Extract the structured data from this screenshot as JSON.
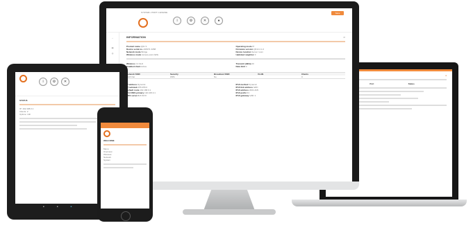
{
  "monitor": {
    "header_title": "SYSTEM • PORT 1 ENGINE",
    "toolbar_button": "Save",
    "info_title": "INFORMATION",
    "left_fields": [
      {
        "label": "Product name",
        "value": "Q61 S"
      },
      {
        "label": "Device serial no.",
        "value": "A08371 3058"
      },
      {
        "label": "Network mode",
        "value": "Bridge"
      },
      {
        "label": "Wireless mode",
        "value": "Access point (W2)"
      }
    ],
    "right_fields": [
      {
        "label": "Operating mode",
        "value": "IP"
      },
      {
        "label": "Firmware version",
        "value": "Q614 2.1.0"
      },
      {
        "label": "Device location",
        "value": "Server room"
      },
      {
        "label": "Uplinked neighbor",
        "value": "3"
      }
    ],
    "section2_fields": [
      {
        "label": "Wireless",
        "value": "2.4 GHz"
      },
      {
        "label": "Enabled client",
        "value": "Active"
      },
      {
        "label": "Transmit (dBm)",
        "value": "20"
      },
      {
        "label": "Data limit",
        "value": "0"
      }
    ],
    "table_headers": [
      "Network SSID",
      "Security",
      "Broadcast SSID",
      "VLAN",
      "Clients"
    ],
    "table_row": [
      "Sixth Net",
      "WPA",
      "No",
      "",
      "0"
    ],
    "bottom_left": [
      {
        "label": "IP address",
        "value": "Dynamic"
      },
      {
        "label": "IP netmask",
        "value": "255.255.0"
      },
      {
        "label": "Default route",
        "value": "192.168.0.1"
      },
      {
        "label": "IPv4 DNS primary",
        "value": "192.168.0.1"
      },
      {
        "label": "DNS server 1",
        "value": "8.8.8.8"
      },
      {
        "label": "DNS server 2",
        "value": ""
      }
    ],
    "bottom_right": [
      {
        "label": "IPv6 method",
        "value": "Dynamic"
      },
      {
        "label": "IPv6 link address",
        "value": "fe80::"
      },
      {
        "label": "IPv6 address",
        "value": "2001:db8::"
      },
      {
        "label": "IPv6 prefix",
        "value": "64"
      },
      {
        "label": "IPv6 gateway",
        "value": "fe80::1"
      },
      {
        "label": "IPv6 DNS server 1",
        "value": "2001:4860::"
      }
    ]
  },
  "tablet": {
    "title": "STATUS",
    "rows": [
      "IP: 192.168.0.1",
      "Clients: 2",
      "Uptime: 14h"
    ]
  },
  "phone": {
    "title": "WELCOME",
    "nav_label": "Menu",
    "items": [
      "Overview",
      "Wireless",
      "Network",
      "System"
    ]
  },
  "laptop": {
    "tab_label": "Status",
    "headers": [
      "Name",
      "Port",
      "Status"
    ]
  },
  "colors": {
    "accent": "#e36f1f",
    "bezel": "#1b1b1b",
    "silver": "#d6d7d8"
  }
}
